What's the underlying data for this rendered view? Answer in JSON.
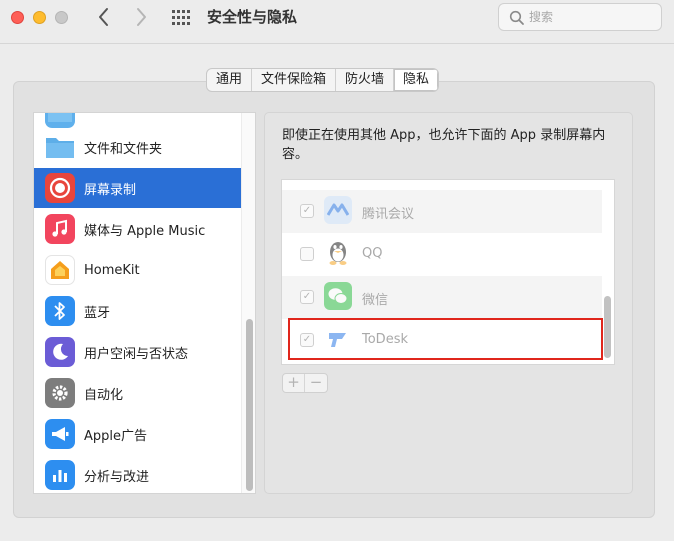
{
  "window": {
    "title": "安全性与隐私",
    "back_icon": "chevron-left-icon",
    "forward_icon": "chevron-right-icon",
    "grid_icon": "grid-icon"
  },
  "search": {
    "placeholder": "搜索",
    "value": ""
  },
  "tabs": [
    {
      "label": "通用",
      "active": false
    },
    {
      "label": "文件保险箱",
      "active": false
    },
    {
      "label": "防火墙",
      "active": false
    },
    {
      "label": "隐私",
      "active": true
    }
  ],
  "sidebar": {
    "items": [
      {
        "label": "",
        "icon": "folder-icon",
        "selected": false
      },
      {
        "label": "文件和文件夹",
        "icon": "folder-icon",
        "selected": false
      },
      {
        "label": "屏幕录制",
        "icon": "screen-record-icon",
        "selected": true
      },
      {
        "label": "媒体与 Apple Music",
        "icon": "music-note-icon",
        "selected": false
      },
      {
        "label": "HomeKit",
        "icon": "home-icon",
        "selected": false
      },
      {
        "label": "蓝牙",
        "icon": "bluetooth-icon",
        "selected": false
      },
      {
        "label": "用户空闲与否状态",
        "icon": "moon-icon",
        "selected": false
      },
      {
        "label": "自动化",
        "icon": "gear-icon",
        "selected": false
      },
      {
        "label": "Apple广告",
        "icon": "megaphone-icon",
        "selected": false
      },
      {
        "label": "分析与改进",
        "icon": "bar-chart-icon",
        "selected": false
      }
    ]
  },
  "main": {
    "description": "即使正在使用其他 App，也允许下面的 App 录制屏幕内容。",
    "apps": [
      {
        "name": "",
        "checked": true
      },
      {
        "name": "腾讯会议",
        "checked": true,
        "icon": "tencent-meeting-icon"
      },
      {
        "name": "QQ",
        "checked": false,
        "icon": "qq-penguin-icon"
      },
      {
        "name": "微信",
        "checked": true,
        "icon": "wechat-icon"
      },
      {
        "name": "ToDesk",
        "checked": true,
        "icon": "todesk-icon"
      }
    ],
    "add_label": "+",
    "remove_label": "−"
  },
  "colors": {
    "selection": "#2a6fd6",
    "highlight": "#e0261c"
  }
}
